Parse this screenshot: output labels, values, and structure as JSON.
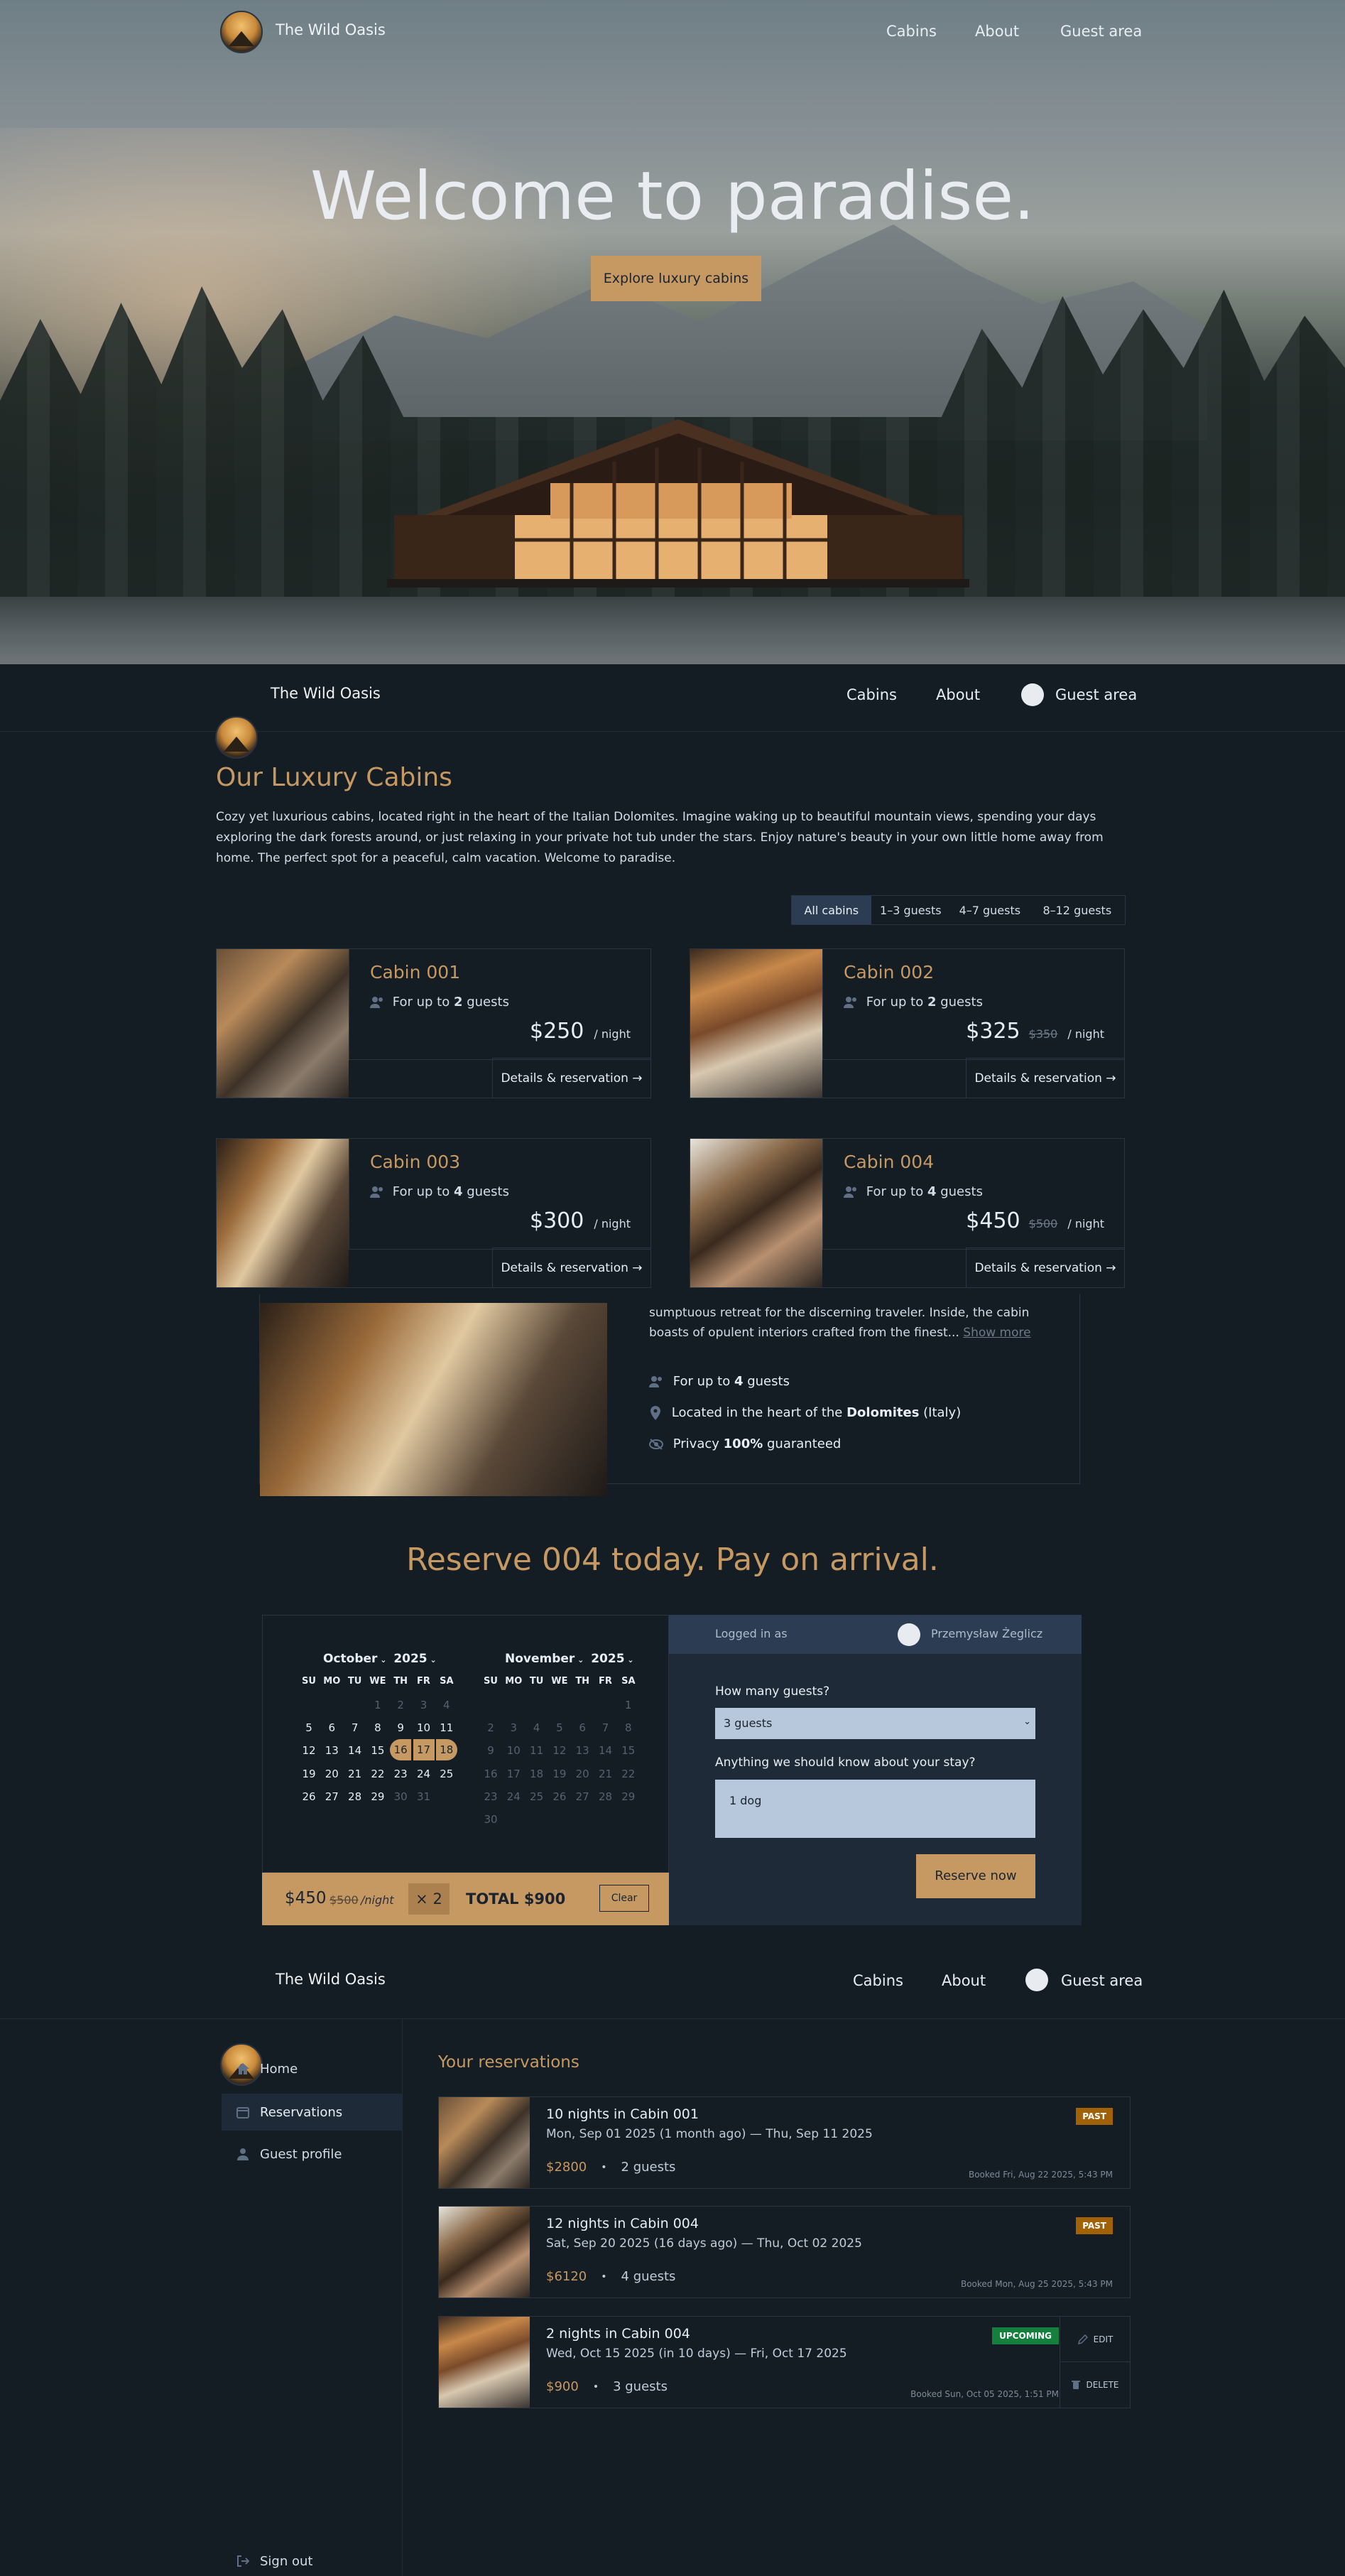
{
  "brand": {
    "name": "The Wild Oasis"
  },
  "nav": {
    "cabins": "Cabins",
    "about": "About",
    "guest_area": "Guest area"
  },
  "hero": {
    "title": "Welcome to paradise.",
    "cta": "Explore luxury cabins"
  },
  "cabins_page": {
    "title": "Our Luxury Cabins",
    "intro": "Cozy yet luxurious cabins, located right in the heart of the Italian Dolomites. Imagine waking up to beautiful mountain views, spending your days exploring the dark forests around, or just relaxing in your private hot tub under the stars. Enjoy nature's beauty in your own little home away from home. The perfect spot for a peaceful, calm vacation. Welcome to paradise.",
    "filters": [
      "All cabins",
      "1–3 guests",
      "4–7 guests",
      "8–12 guests"
    ],
    "active_filter": "All cabins",
    "guests_prefix": "For up to",
    "guests_suffix": "guests",
    "per_night": "/ night",
    "details_label": "Details & reservation →",
    "cabins": [
      {
        "name": "Cabin 001",
        "guests": "2",
        "price": "$250",
        "old_price": ""
      },
      {
        "name": "Cabin 002",
        "guests": "2",
        "price": "$325",
        "old_price": "$350"
      },
      {
        "name": "Cabin 003",
        "guests": "4",
        "price": "$300",
        "old_price": ""
      },
      {
        "name": "Cabin 004",
        "guests": "4",
        "price": "$450",
        "old_price": "$500"
      }
    ]
  },
  "cabin_detail": {
    "description": "sumptuous retreat for the discerning traveler. Inside, the cabin boasts of opulent interiors crafted from the finest...",
    "show_more": "Show more",
    "f1_pre": "For up to",
    "f1_bold": "4",
    "f1_post": "guests",
    "f2_pre": "Located in the heart of the",
    "f2_bold": "Dolomites",
    "f2_post": "(Italy)",
    "f3_pre": "Privacy",
    "f3_bold": "100%",
    "f3_post": "guaranteed"
  },
  "reserve": {
    "title": "Reserve 004 today. Pay on arrival.",
    "months": [
      {
        "month": "October",
        "year": "2025"
      },
      {
        "month": "November",
        "year": "2025"
      }
    ],
    "weekdays": [
      "SU",
      "MO",
      "TU",
      "WE",
      "TH",
      "FR",
      "SA"
    ],
    "logged_in_label": "Logged in as",
    "user_name": "Przemysław Żeglicz",
    "guests_question": "How many guests?",
    "guests_value": "3 guests",
    "notes_question": "Anything we should know about your stay?",
    "notes_value": "1 dog",
    "reserve_button": "Reserve now",
    "summary": {
      "price": "$450",
      "old_price": "$500",
      "per_night": "/night",
      "nights": "× 2",
      "total": "TOTAL $900",
      "clear": "Clear"
    }
  },
  "account": {
    "sidebar": [
      "Home",
      "Reservations",
      "Guest profile"
    ],
    "active": "Reservations",
    "sign_out": "Sign out",
    "title": "Your reservations",
    "reservations": [
      {
        "title": "10 nights in Cabin 001",
        "dates": "Mon, Sep 01 2025 (1 month ago) — Thu, Sep 11 2025",
        "price": "$2800",
        "guests": "2 guests",
        "booked": "Booked Fri, Aug 22 2025, 5:43 PM",
        "status": "PAST"
      },
      {
        "title": "12 nights in Cabin 004",
        "dates": "Sat, Sep 20 2025 (16 days ago) — Thu, Oct 02 2025",
        "price": "$6120",
        "guests": "4 guests",
        "booked": "Booked Mon, Aug 25 2025, 5:43 PM",
        "status": "PAST"
      },
      {
        "title": "2 nights in Cabin 004",
        "dates": "Wed, Oct 15 2025 (in 10 days) — Fri, Oct 17 2025",
        "price": "$900",
        "guests": "3 guests",
        "booked": "Booked Sun, Oct 05 2025, 1:51 PM",
        "status": "UPCOMING"
      }
    ],
    "dot": "•",
    "edit": "EDIT",
    "delete": "DELETE"
  },
  "colors": {
    "accent": "#c69963",
    "bg": "#141c24",
    "past": "#a16207",
    "upcoming": "#15803d"
  }
}
